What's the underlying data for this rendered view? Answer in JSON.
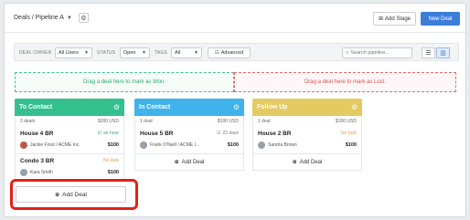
{
  "header": {
    "breadcrumb": "Deals / Pipeline A",
    "add_stage_label": "Add Stage",
    "new_deal_label": "New Deal"
  },
  "filters": {
    "deal_owner_label": "DEAL OWNER",
    "deal_owner_value": "All Users",
    "status_label": "STATUS",
    "status_value": "Open",
    "tags_label": "TAGS",
    "tags_value": "All",
    "advanced_label": "Advanced",
    "search_placeholder": "Search pipeline..."
  },
  "drop_zones": {
    "won": "Drag a deal here to mark as Won.",
    "lost": "Drag a deal here to mark as Lost."
  },
  "columns": [
    {
      "title": "To Contact",
      "color": "#33c08d",
      "deal_count": "2 deals",
      "total": "$200 USD",
      "deals": [
        {
          "title": "House 4 BR",
          "task": "an hour",
          "task_icon": "check-icon",
          "person": "Jackie Frost / ACME Inc.",
          "amount": "$100"
        },
        {
          "title": "Condo 3 BR",
          "task": "No task",
          "person": "Kara Smith",
          "amount": "$100"
        }
      ],
      "add_label": "Add Deal"
    },
    {
      "title": "In Contact",
      "color": "#3fb3ea",
      "deal_count": "1 deal",
      "total": "$100 USD",
      "deals": [
        {
          "title": "House 5 BR",
          "task": "22 days",
          "task_icon": "check-icon",
          "person": "Frank O'Neill / ACME I...",
          "amount": "$100"
        }
      ],
      "add_label": "Add Deal"
    },
    {
      "title": "Follow Up",
      "color": "#e5ca62",
      "deal_count": "1 deal",
      "total": "$100 USD",
      "deals": [
        {
          "title": "House 2 BR",
          "task": "No task",
          "person": "Sandra Brown",
          "amount": "$100"
        }
      ],
      "add_label": "Add Deal"
    }
  ],
  "highlighted_button": {
    "label": "Add Deal",
    "highlight_color": "#e32119"
  }
}
